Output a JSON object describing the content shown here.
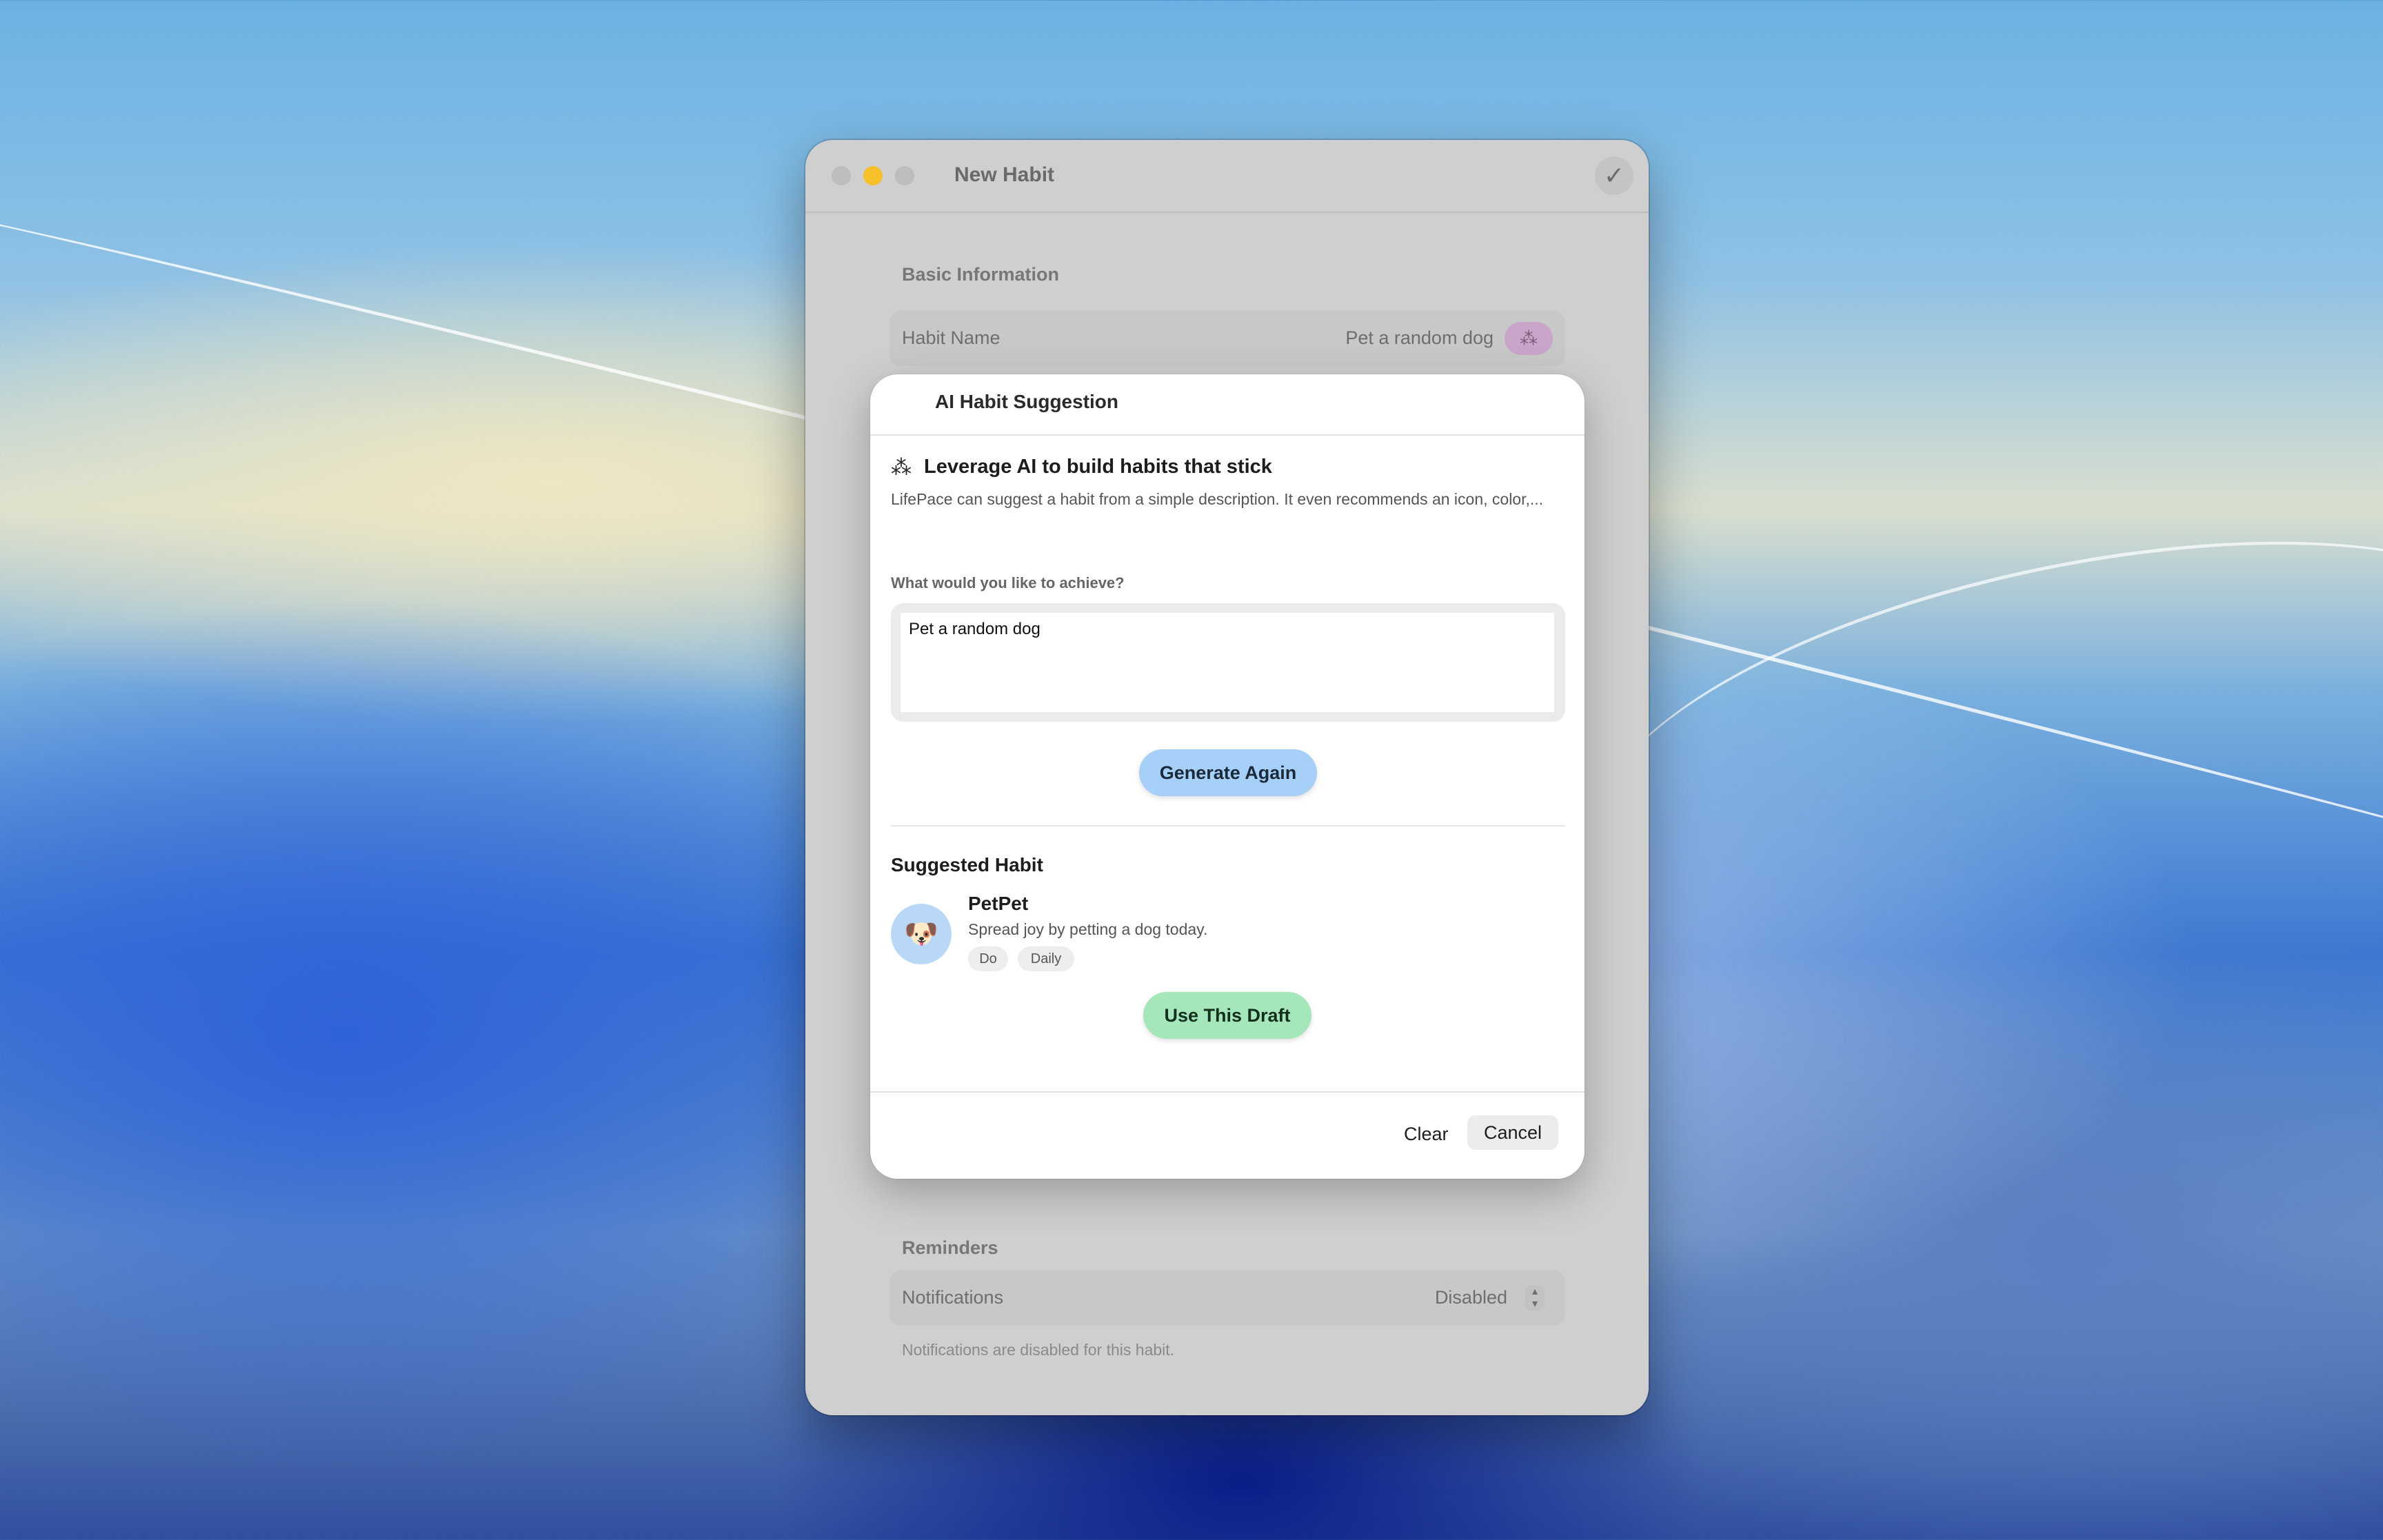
{
  "window": {
    "title": "New Habit",
    "confirm_icon": "checkmark-icon",
    "basic_section": "Basic Information",
    "habit_name_label": "Habit Name",
    "habit_name_value": "Pet a random dog",
    "reminders_section": "Reminders",
    "notifications_label": "Notifications",
    "notifications_value": "Disabled",
    "notifications_hint": "Notifications are disabled for this habit."
  },
  "sheet": {
    "title": "AI Habit Suggestion",
    "headline": "Leverage AI to build habits that stick",
    "description": "LifePace can suggest a habit from a simple description. It even recommends an icon, color,...",
    "prompt_label": "What would you like to achieve?",
    "prompt_value": "Pet a random dog",
    "generate_button": "Generate Again",
    "suggested_title": "Suggested Habit",
    "suggestion": {
      "emoji": "🐶",
      "name": "PetPet",
      "description": "Spread joy by petting a dog today.",
      "tags": [
        "Do",
        "Daily"
      ]
    },
    "use_button": "Use This Draft",
    "clear_button": "Clear",
    "cancel_button": "Cancel"
  },
  "colors": {
    "generate_button": "#a6d0f7",
    "use_button": "#a6e6bb",
    "wand_chip": "#c9a6c9",
    "minimize_light": "#f5c02a"
  }
}
